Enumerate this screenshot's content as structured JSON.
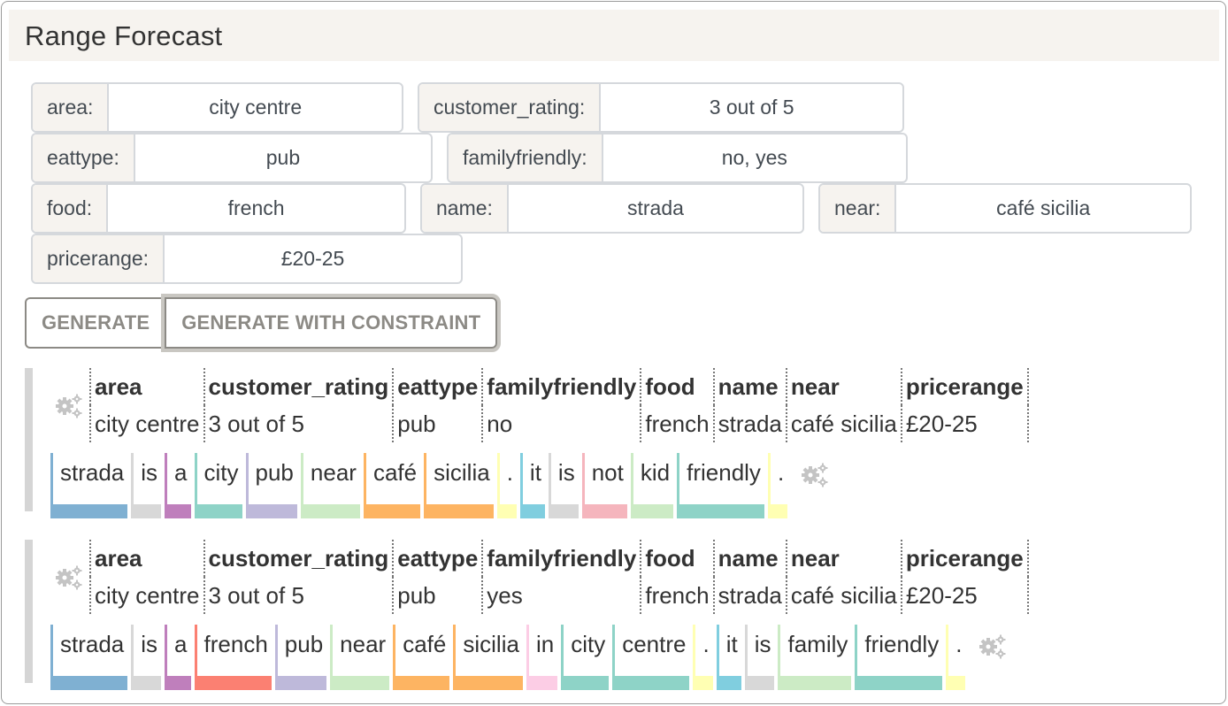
{
  "header": {
    "title": "Range Forecast"
  },
  "filters": [
    {
      "label": "area:",
      "value": "city centre"
    },
    {
      "label": "customer_rating:",
      "value": "3 out of 5"
    },
    {
      "label": "eattype:",
      "value": "pub"
    },
    {
      "label": "familyfriendly:",
      "value": "no, yes"
    },
    {
      "label": "food:",
      "value": "french"
    },
    {
      "label": "name:",
      "value": "strada"
    },
    {
      "label": "near:",
      "value": "café sicilia"
    },
    {
      "label": "pricerange:",
      "value": "£20-25"
    }
  ],
  "buttons": {
    "generate": "GENERATE",
    "generate_constraint": "GENERATE WITH CONSTRAINT"
  },
  "colors": {
    "name": "#7fb0d2",
    "function": "#d8d8d8",
    "article": "#bf7fbc",
    "area": "#8ed3c7",
    "eattype": "#beb9da",
    "near_rel": "#ccebc5",
    "near": "#fdb462",
    "punct": "#ffffb3",
    "pronoun": "#80cedf",
    "negation": "#f5b5bd",
    "food": "#fb8072",
    "prep": "#fccde5",
    "familyfriendly": "#8ed3c7"
  },
  "results": [
    {
      "columns": [
        "area",
        "customer_rating",
        "eattype",
        "familyfriendly",
        "food",
        "name",
        "near",
        "pricerange"
      ],
      "values": [
        "city centre",
        "3 out of 5",
        "pub",
        "no",
        "french",
        "strada",
        "café sicilia",
        "£20-25"
      ],
      "tokens": [
        {
          "text": "strada",
          "color": "#7fb0d2"
        },
        {
          "text": "is",
          "color": "#d8d8d8"
        },
        {
          "text": "a",
          "color": "#bf7fbc"
        },
        {
          "text": "city",
          "color": "#8ed3c7"
        },
        {
          "text": "pub",
          "color": "#beb9da"
        },
        {
          "text": "near",
          "color": "#ccebc5"
        },
        {
          "text": "café",
          "color": "#fdb462"
        },
        {
          "text": "sicilia",
          "color": "#fdb462"
        },
        {
          "text": ".",
          "color": "#ffffb3"
        },
        {
          "text": "it",
          "color": "#80cedf"
        },
        {
          "text": "is",
          "color": "#d8d8d8"
        },
        {
          "text": "not",
          "color": "#f5b5bd"
        },
        {
          "text": "kid",
          "color": "#ccebc5"
        },
        {
          "text": "friendly",
          "color": "#8ed3c7"
        },
        {
          "text": ".",
          "color": "#ffffb3"
        }
      ]
    },
    {
      "columns": [
        "area",
        "customer_rating",
        "eattype",
        "familyfriendly",
        "food",
        "name",
        "near",
        "pricerange"
      ],
      "values": [
        "city centre",
        "3 out of 5",
        "pub",
        "yes",
        "french",
        "strada",
        "café sicilia",
        "£20-25"
      ],
      "tokens": [
        {
          "text": "strada",
          "color": "#7fb0d2"
        },
        {
          "text": "is",
          "color": "#d8d8d8"
        },
        {
          "text": "a",
          "color": "#bf7fbc"
        },
        {
          "text": "french",
          "color": "#fb8072"
        },
        {
          "text": "pub",
          "color": "#beb9da"
        },
        {
          "text": "near",
          "color": "#ccebc5"
        },
        {
          "text": "café",
          "color": "#fdb462"
        },
        {
          "text": "sicilia",
          "color": "#fdb462"
        },
        {
          "text": "in",
          "color": "#fccde5"
        },
        {
          "text": "city",
          "color": "#8ed3c7"
        },
        {
          "text": "centre",
          "color": "#8ed3c7"
        },
        {
          "text": ".",
          "color": "#ffffb3"
        },
        {
          "text": "it",
          "color": "#80cedf"
        },
        {
          "text": "is",
          "color": "#d8d8d8"
        },
        {
          "text": "family",
          "color": "#ccebc5"
        },
        {
          "text": "friendly",
          "color": "#8ed3c7"
        },
        {
          "text": ".",
          "color": "#ffffb3"
        }
      ]
    }
  ]
}
